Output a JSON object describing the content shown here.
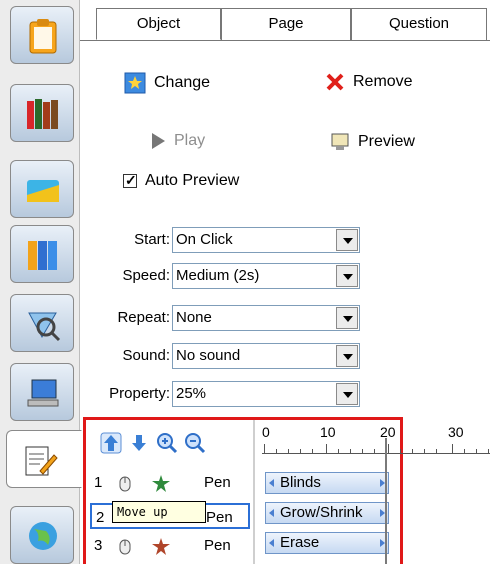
{
  "sidebar": {
    "tabs": [
      {
        "icon": "clipboard-icon"
      },
      {
        "icon": "books-icon"
      },
      {
        "icon": "card-icon"
      },
      {
        "icon": "binders-icon"
      },
      {
        "icon": "magnifier-shape-icon"
      },
      {
        "icon": "monitor-icon"
      },
      {
        "icon": "edit-document-icon",
        "active": true
      },
      {
        "icon": "globe-icon"
      }
    ]
  },
  "tabs": [
    "Object",
    "Page",
    "Question"
  ],
  "actions": {
    "change": "Change",
    "remove": "Remove",
    "play": "Play",
    "preview": "Preview"
  },
  "auto_preview": {
    "label": "Auto Preview",
    "checked": true
  },
  "fields": {
    "start": {
      "label": "Start:",
      "value": "On Click"
    },
    "speed": {
      "label": "Speed:",
      "value": "Medium (2s)"
    },
    "repeat": {
      "label": "Repeat:",
      "value": "None"
    },
    "sound": {
      "label": "Sound:",
      "value": "No sound"
    },
    "property": {
      "label": "Property:",
      "value": "25%"
    }
  },
  "sequence": {
    "tooltip": "Move up",
    "rows": [
      {
        "num": "1",
        "name": "Pen"
      },
      {
        "num": "2",
        "name": "Pen"
      },
      {
        "num": "3",
        "name": "Pen"
      }
    ]
  },
  "timeline": {
    "ruler": [
      "0",
      "10",
      "20",
      "30"
    ],
    "bars": [
      "Blinds",
      "Grow/Shrink",
      "Erase"
    ]
  },
  "colors": {
    "highlight": "#e01818",
    "selection": "#2b6fd6",
    "accent": "#3a7fd5"
  }
}
